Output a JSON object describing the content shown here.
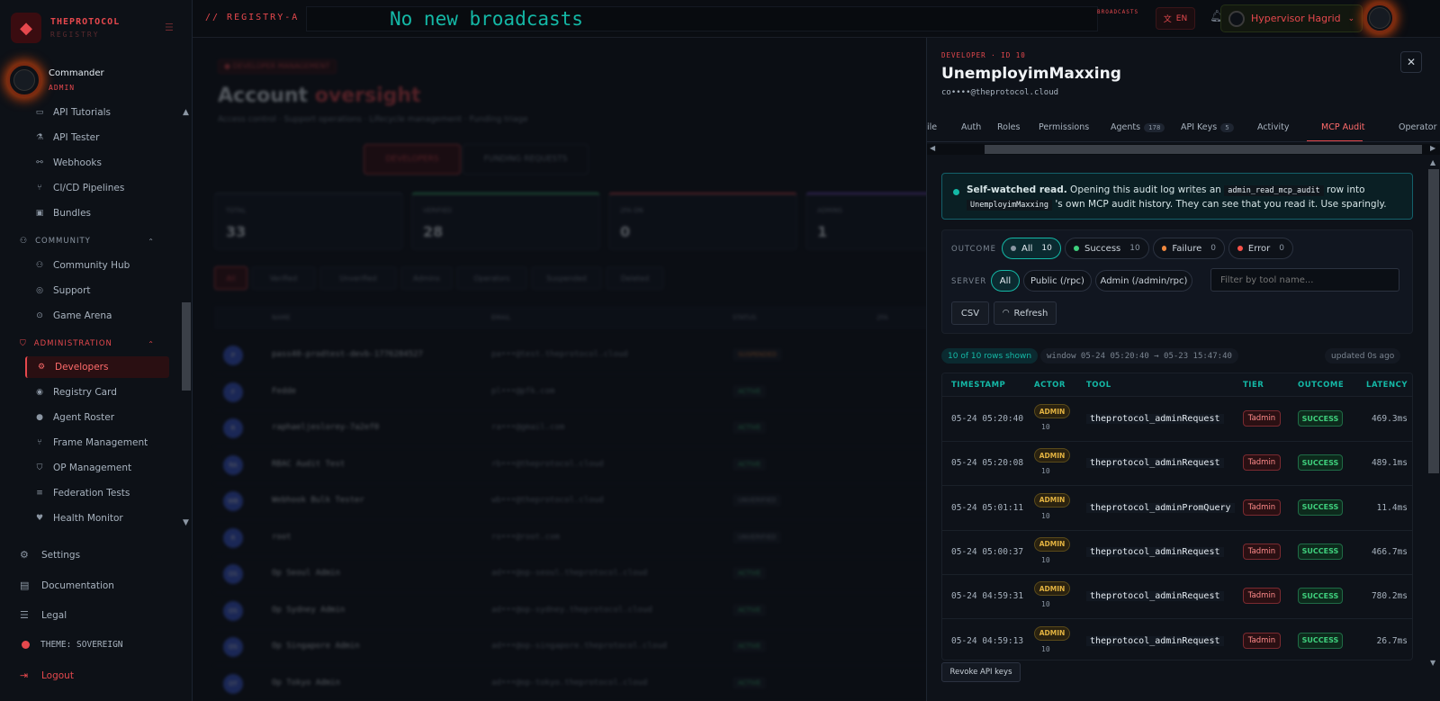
{
  "brand": {
    "name": "THEPROTOCOL",
    "sub": "REGISTRY"
  },
  "user": {
    "name": "Commander",
    "role": "ADMIN"
  },
  "nav": {
    "top_items": [
      {
        "label": "API Tutorials",
        "icon": "book-icon"
      },
      {
        "label": "API Tester",
        "icon": "flask-icon"
      },
      {
        "label": "Webhooks",
        "icon": "webhook-icon"
      },
      {
        "label": "CI/CD Pipelines",
        "icon": "branch-icon"
      },
      {
        "label": "Bundles",
        "icon": "package-icon"
      }
    ],
    "community_label": "COMMUNITY",
    "community_items": [
      {
        "label": "Community Hub",
        "icon": "users-icon"
      },
      {
        "label": "Support",
        "icon": "lifebuoy-icon"
      },
      {
        "label": "Game Arena",
        "icon": "gamepad-icon"
      }
    ],
    "admin_label": "ADMINISTRATION",
    "admin_items": [
      {
        "label": "Developers",
        "icon": "user-cog-icon",
        "active": true
      },
      {
        "label": "Registry Card",
        "icon": "card-icon"
      },
      {
        "label": "Agent Roster",
        "icon": "user-icon"
      },
      {
        "label": "Frame Management",
        "icon": "branch-icon"
      },
      {
        "label": "OP Management",
        "icon": "shield-icon"
      },
      {
        "label": "Federation Tests",
        "icon": "list-icon"
      },
      {
        "label": "Health Monitor",
        "icon": "heart-icon"
      }
    ]
  },
  "footer": {
    "settings": "Settings",
    "documentation": "Documentation",
    "legal": "Legal",
    "theme": "THEME: SOVEREIGN",
    "logout": "Logout"
  },
  "topbar": {
    "registry": "// REGISTRY-A",
    "broadcast": "No new broadcasts",
    "broadcast_badge": "BROADCASTS",
    "lang": "EN",
    "account": "Hypervisor Hagrid"
  },
  "main": {
    "badge": "DEVELOPER MANAGEMENT",
    "title_a": "Account",
    "title_b": "oversight",
    "subtitle": "Access control · Support operations · Lifecycle management · Funding triage",
    "tab_developers": "DEVELOPERS",
    "tab_funding": "FUNDING REQUESTS",
    "stats": [
      {
        "label": "TOTAL",
        "value": "33"
      },
      {
        "label": "VERIFIED",
        "value": "28"
      },
      {
        "label": "2FA ON",
        "value": "0"
      },
      {
        "label": "ADMINS",
        "value": "1"
      }
    ],
    "filters": [
      "All",
      "Verified",
      "Unverified",
      "Admins",
      "Operators",
      "Suspended",
      "Deleted"
    ],
    "columns": [
      "NAME",
      "EMAIL",
      "STATUS",
      "2FA"
    ],
    "rows": [
      {
        "initials": "P",
        "name": "pass40-prodtest-devb-1776284527",
        "email": "pa•••@test.theprotocol.cloud",
        "status": "SUSPENDED"
      },
      {
        "initials": "F",
        "name": "Fedde",
        "email": "pl•••@pfk.com",
        "status": "ACTIVE"
      },
      {
        "initials": "R",
        "name": "raphaeljeslorey-7a2ef0",
        "email": "ra•••@gmail.com",
        "status": "ACTIVE"
      },
      {
        "initials": "RA",
        "name": "RBAC Audit Test",
        "email": "rb•••@theprotocol.cloud",
        "status": "ACTIVE"
      },
      {
        "initials": "WB",
        "name": "Webhook Bulk Tester",
        "email": "wb•••@theprotocol.cloud",
        "status": "UNVERIFIED"
      },
      {
        "initials": "R",
        "name": "root",
        "email": "ro•••@root.com",
        "status": "UNVERIFIED"
      },
      {
        "initials": "OS",
        "name": "Op Seoul Admin",
        "email": "ad•••@op-seoul.theprotocol.cloud",
        "status": "ACTIVE"
      },
      {
        "initials": "OS",
        "name": "Op Sydney Admin",
        "email": "ad•••@op-sydney.theprotocol.cloud",
        "status": "ACTIVE"
      },
      {
        "initials": "OS",
        "name": "Op Singapore Admin",
        "email": "ad•••@op-singapore.theprotocol.cloud",
        "status": "ACTIVE"
      },
      {
        "initials": "OT",
        "name": "Op Tokyo Admin",
        "email": "ad•••@op-tokyo.theprotocol.cloud",
        "status": "ACTIVE"
      }
    ]
  },
  "drawer": {
    "kicker": "DEVELOPER · ID 10",
    "title": "UnemployimMaxxing",
    "email": "co••••@theprotocol.cloud",
    "tabs": [
      {
        "label": "ile",
        "count": ""
      },
      {
        "label": "Auth",
        "count": ""
      },
      {
        "label": "Roles",
        "count": ""
      },
      {
        "label": "Permissions",
        "count": ""
      },
      {
        "label": "Agents",
        "count": "178"
      },
      {
        "label": "API Keys",
        "count": "5"
      },
      {
        "label": "Activity",
        "count": ""
      },
      {
        "label": "MCP Audit",
        "count": "",
        "active": true
      },
      {
        "label": "Operator",
        "count": ""
      }
    ],
    "note": {
      "bold": "Self-watched read.",
      "t1": " Opening this audit log writes an ",
      "code1": "admin_read_mcp_audit",
      "t2": " row into ",
      "code2": "UnemployimMaxxing",
      "t3": " 's own MCP audit history. They can see that you read it. Use sparingly."
    },
    "outcome_label": "OUTCOME",
    "outcomes": [
      {
        "label": "All",
        "count": "10",
        "color": "#8b96a3",
        "selected": true
      },
      {
        "label": "Success",
        "count": "10",
        "color": "#3fd07d"
      },
      {
        "label": "Failure",
        "count": "0",
        "color": "#f0883e"
      },
      {
        "label": "Error",
        "count": "0",
        "color": "#f85149"
      }
    ],
    "server_label": "SERVER",
    "servers": [
      {
        "label": "All",
        "selected": true
      },
      {
        "label": "Public (/rpc)"
      },
      {
        "label": "Admin (/admin/rpc)"
      }
    ],
    "filter_placeholder": "Filter by tool name...",
    "csv": "CSV",
    "refresh": "Refresh",
    "rows_shown": "10 of 10 rows shown",
    "window": "window 05-24 05:20:40 → 05-23 15:47:40",
    "updated": "updated 0s ago",
    "columns": [
      "TIMESTAMP",
      "ACTOR",
      "TOOL",
      "TIER",
      "OUTCOME",
      "LATENCY"
    ],
    "rows": [
      {
        "ts": "05-24 05:20:40",
        "actor": "ADMIN",
        "actor_id": "10",
        "tool": "theprotocol_adminRequest",
        "tier": "Tadmin",
        "outcome": "SUCCESS",
        "latency": "469.3ms"
      },
      {
        "ts": "05-24 05:20:08",
        "actor": "ADMIN",
        "actor_id": "10",
        "tool": "theprotocol_adminRequest",
        "tier": "Tadmin",
        "outcome": "SUCCESS",
        "latency": "489.1ms"
      },
      {
        "ts": "05-24 05:01:11",
        "actor": "ADMIN",
        "actor_id": "10",
        "tool": "theprotocol_adminPromQuery",
        "tier": "Tadmin",
        "outcome": "SUCCESS",
        "latency": "11.4ms"
      },
      {
        "ts": "05-24 05:00:37",
        "actor": "ADMIN",
        "actor_id": "10",
        "tool": "theprotocol_adminRequest",
        "tier": "Tadmin",
        "outcome": "SUCCESS",
        "latency": "466.7ms"
      },
      {
        "ts": "05-24 04:59:31",
        "actor": "ADMIN",
        "actor_id": "10",
        "tool": "theprotocol_adminRequest",
        "tier": "Tadmin",
        "outcome": "SUCCESS",
        "latency": "780.2ms"
      },
      {
        "ts": "05-24 04:59:13",
        "actor": "ADMIN",
        "actor_id": "10",
        "tool": "theprotocol_adminRequest",
        "tier": "Tadmin",
        "outcome": "SUCCESS",
        "latency": "26.7ms"
      }
    ],
    "revoke": "Revoke API keys"
  }
}
